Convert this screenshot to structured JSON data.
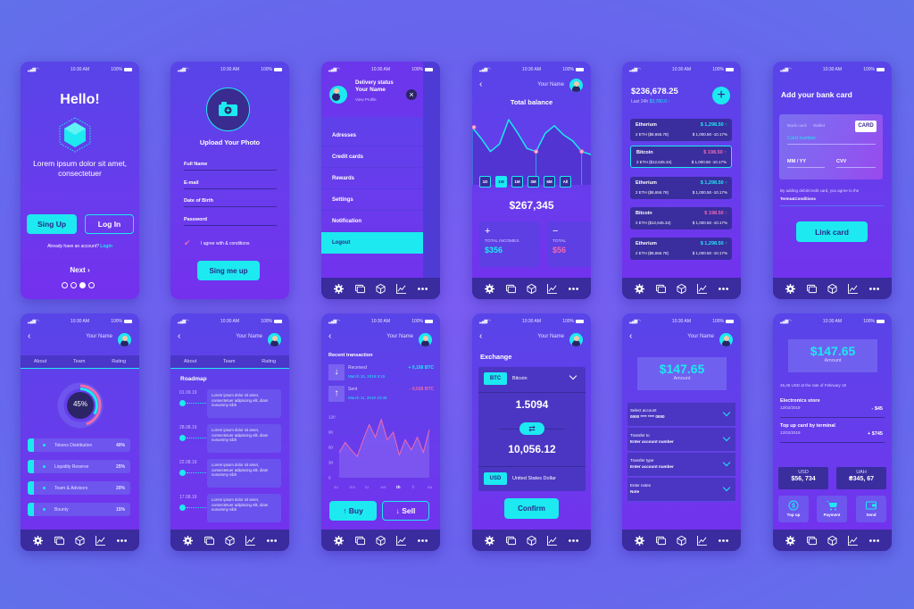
{
  "status": {
    "time": "10:30 AM",
    "battery": "100%"
  },
  "colors": {
    "background": "#6a62ee",
    "phone": "#5f40ea",
    "accent": "#1de9f0",
    "negative": "#f06ab0",
    "nav": "#3a2b9e"
  },
  "nav_icons": [
    "gear-icon",
    "cards-icon",
    "cube-icon",
    "chart-icon",
    "more-icon"
  ],
  "user_name": "Your Name",
  "welcome": {
    "title": "Hello!",
    "text": "Lorem ipsum dolor sit amet, consectetuer",
    "signup": "Sing Up",
    "login": "Log In",
    "have_account": "Already have an account?",
    "login_link": "Login",
    "next": "Next",
    "page_dots": 4,
    "active_dot": 3
  },
  "upload": {
    "title": "Upload Your Photo",
    "fields": [
      "Full Name",
      "E-mail",
      "Date of Birth",
      "Password"
    ],
    "agree": "I agree with & conditions",
    "agree_checked": true,
    "submit": "Sing me up"
  },
  "menu": {
    "status": "Delivery status",
    "name": "Your Name",
    "view_profile": "View Profile",
    "items": [
      "Adresses",
      "Credit cards",
      "Rewards",
      "Settings",
      "Notification",
      "Logout"
    ],
    "active": "Logout"
  },
  "balance": {
    "title": "Total balance",
    "periods": [
      "1D",
      "1W",
      "1M",
      "3M",
      "6M",
      "All"
    ],
    "active_period": "1W",
    "total": "$267,345",
    "incomes_label": "TOTAL INCOMES",
    "incomes": "$356",
    "expenses_label": "TOTAL",
    "expenses": "$56",
    "chart_values": [
      70,
      55,
      38,
      48,
      80,
      62,
      42,
      38,
      62,
      72,
      60,
      52,
      38,
      34
    ]
  },
  "wallet": {
    "total": "$236,678.25",
    "last24_label": "Last 24h",
    "last24": "$3,780.0",
    "selected": 1,
    "coins": [
      {
        "name": "Etherium",
        "price": "$ 1,298.50",
        "holding": "2 ETH ($8,656.78)",
        "change": "$ 1,000.50 -10.17%",
        "trend": "up"
      },
      {
        "name": "Bitcoin",
        "price": "$ 198.50",
        "holding": "2 ETH ($12,645.34)",
        "change": "$ 1,000.50 -10.17%",
        "trend": "down"
      },
      {
        "name": "Etherium",
        "price": "$ 1,298.50",
        "holding": "2 ETH ($8,656.78)",
        "change": "$ 1,000.50 -10.17%",
        "trend": "up"
      },
      {
        "name": "Bitcoin",
        "price": "$ 198.50",
        "holding": "2 ETH ($12,645.34)",
        "change": "$ 1,000.50 -10.17%",
        "trend": "down"
      },
      {
        "name": "Etherium",
        "price": "$ 1,298.50",
        "holding": "2 ETH ($8,656.78)",
        "change": "$ 1,000.50 -10.17%",
        "trend": "up"
      }
    ]
  },
  "bank": {
    "title": "Add your bank card",
    "tabs": [
      "Bank card",
      "Wallet"
    ],
    "card_badge": "CARD",
    "card_number": "Card number",
    "expiry": "MM / YY",
    "cvv": "CVV",
    "terms_text": "By adding debit/credit card, you agree to the",
    "terms_link": "Terms&Conditions",
    "button": "Link card"
  },
  "team": {
    "tabs": [
      "About",
      "Team",
      "Rating"
    ],
    "active_tab": "Team",
    "percent": "45%",
    "progress": 0.45,
    "items": [
      {
        "label": "Tokens Distribution",
        "value": "40%"
      },
      {
        "label": "Liquidity Reserve",
        "value": "25%"
      },
      {
        "label": "Team & Advisors",
        "value": "20%"
      },
      {
        "label": "Bounty",
        "value": "15%"
      }
    ]
  },
  "roadmap": {
    "title": "Roadmap",
    "entries": [
      {
        "date": "01.09.19",
        "text": "Lorem ipsum dolor sit amet, consectetuer adipiscing elit, diam nonummy nibh"
      },
      {
        "date": "28.08.19",
        "text": "Lorem ipsum dolor sit amet, consectetuer adipiscing elit, diam nonummy nibh"
      },
      {
        "date": "22.08.19",
        "text": "Lorem ipsum dolor sit amet, consectetuer adipiscing elit, diam nonummy nibh"
      },
      {
        "date": "17.08.19",
        "text": "Lorem ipsum dolor sit amet, consectetuer adipiscing elit, diam nonummy nibh"
      }
    ]
  },
  "transactions": {
    "title": "Recent transaction",
    "items": [
      {
        "type": "Received",
        "amount": "+ 0,108 BTC",
        "date": "March 15, 2019 9:15"
      },
      {
        "type": "Sent",
        "amount": "- 0,028 BTC",
        "date": "March 11, 2019 10:45"
      }
    ],
    "chart": {
      "yticks": [
        "120",
        "90",
        "60",
        "30",
        "0"
      ],
      "ylim": [
        0,
        120
      ],
      "days": [
        "su",
        "mo",
        "tu",
        "we",
        "th",
        "fr",
        "sa"
      ],
      "active_day": "th",
      "values": [
        50,
        70,
        55,
        42,
        75,
        105,
        80,
        115,
        75,
        90,
        45,
        75,
        55,
        80,
        50,
        95
      ]
    },
    "buy": "Buy",
    "sell": "Sell"
  },
  "exchange": {
    "title": "Exchange",
    "from_code": "BTC",
    "from_name": "Bitcoin",
    "from_amount": "1.5094",
    "to_amount": "10,056.12",
    "to_code": "USD",
    "to_name": "United States Dollar",
    "button": "Confirm"
  },
  "transfer": {
    "amount": "$147.65",
    "amount_label": "Amount",
    "fields": [
      {
        "label": "Select account",
        "value": "0000 **** **** 0000"
      },
      {
        "label": "Transfer to",
        "value": "Enter account number"
      },
      {
        "label": "Transfer type",
        "value": "Enter account number"
      },
      {
        "label": "Enter notes",
        "value": "Note"
      }
    ]
  },
  "payment": {
    "amount": "$147.65",
    "amount_label": "Amount",
    "rate_note": "45,45 USD at the rate of February 18",
    "entries": [
      {
        "title": "Electronics store",
        "date": "12/02/2019",
        "amount": "- $45"
      },
      {
        "title": "Top up card by terminal",
        "date": "12/02/2019",
        "amount": "+ $745"
      }
    ],
    "balances": [
      {
        "currency": "USD",
        "value": "$56, 734"
      },
      {
        "currency": "UAH",
        "value": "₴345, 67"
      }
    ],
    "actions": [
      "Top up",
      "Payment",
      "Send"
    ]
  }
}
